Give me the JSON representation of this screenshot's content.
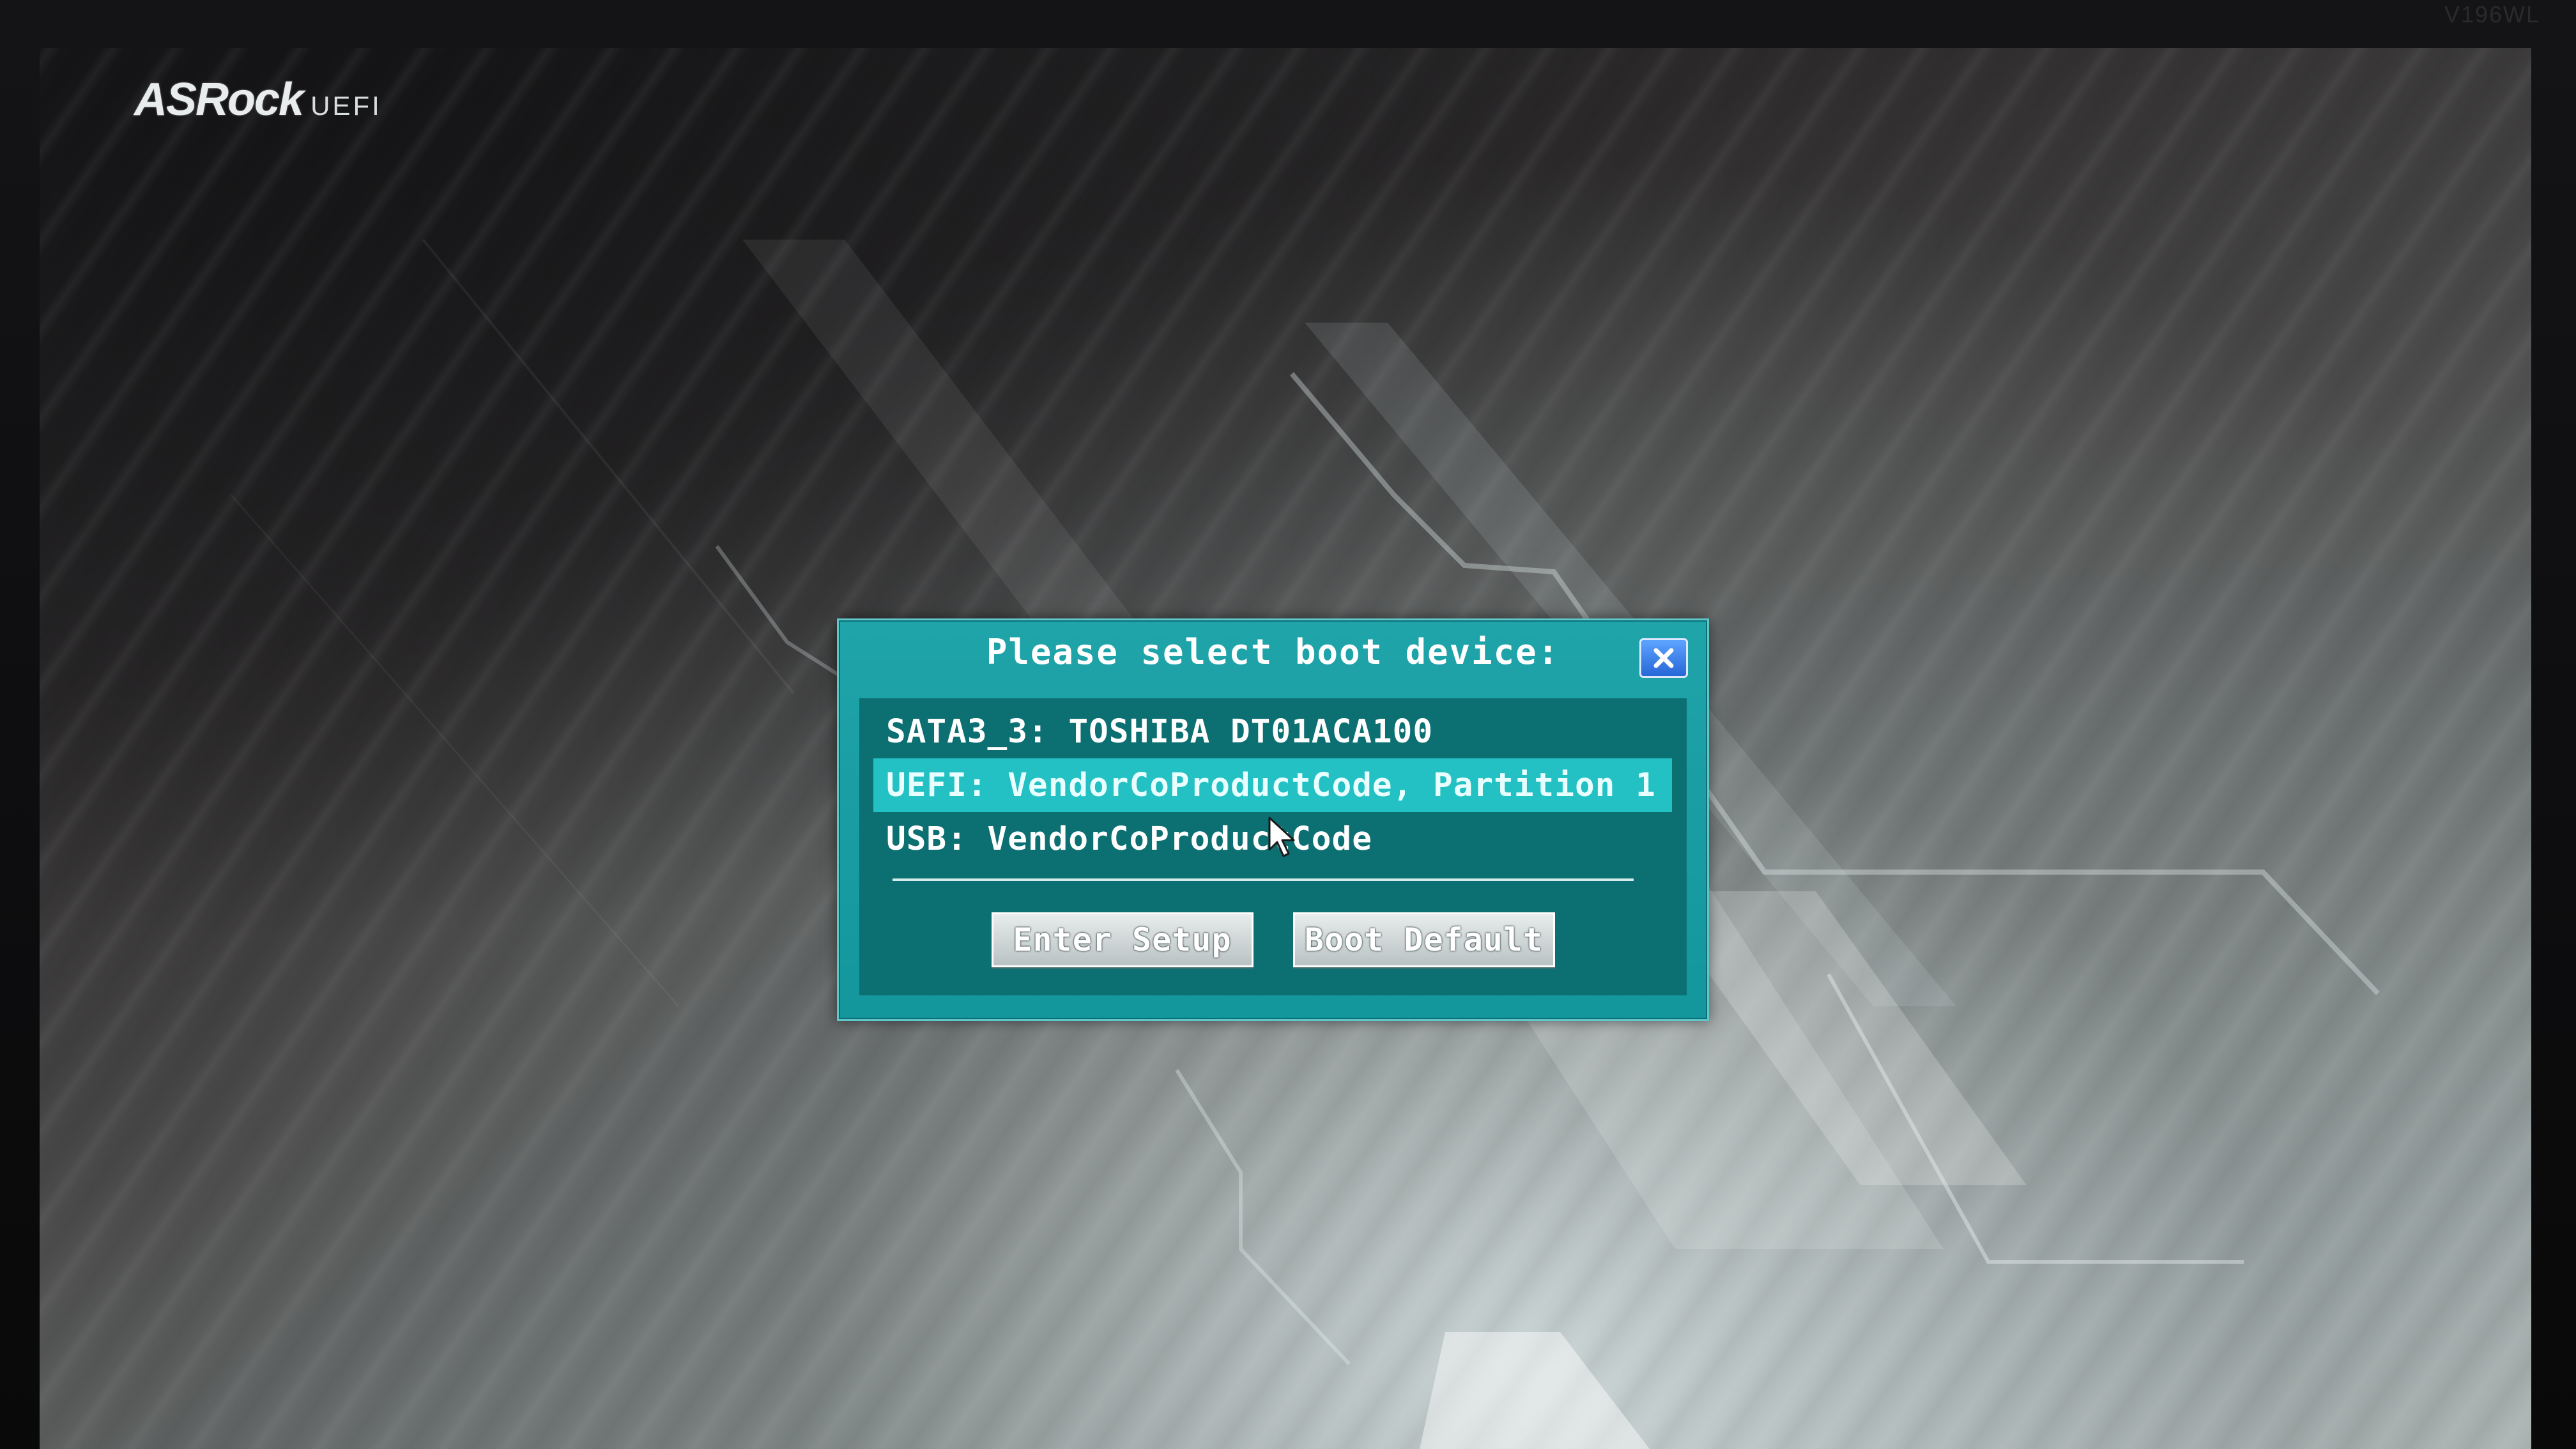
{
  "monitor": {
    "model_label": "V196WL"
  },
  "logo": {
    "brand": "ASRock",
    "suffix": "UEFI"
  },
  "boot_menu": {
    "title": "Please select boot device:",
    "close_icon": "close-icon",
    "devices": [
      {
        "label": "SATA3_3: TOSHIBA DT01ACA100",
        "selected": false
      },
      {
        "label": "UEFI: VendorCoProductCode, Partition 1",
        "selected": true
      },
      {
        "label": "USB: VendorCoProductCode",
        "selected": false
      }
    ],
    "buttons": {
      "enter_setup": "Enter Setup",
      "boot_default": "Boot Default"
    }
  },
  "colors": {
    "dialog_bg": "#13969c",
    "panel_bg": "#0c6f72",
    "selected_row": "#23c1c3",
    "close_button": "#2767d8"
  }
}
